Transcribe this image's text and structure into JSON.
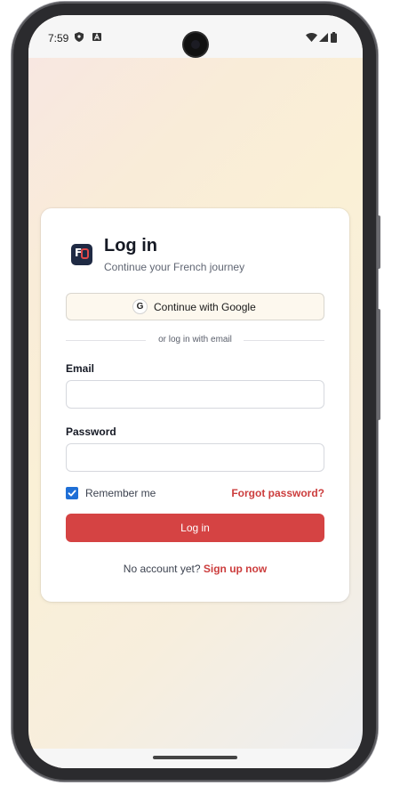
{
  "status_bar": {
    "time": "7:59",
    "left_icons": [
      "shield-icon",
      "a-badge-icon"
    ],
    "right_icons": [
      "wifi-icon",
      "signal-icon",
      "battery-icon"
    ]
  },
  "login": {
    "title": "Log in",
    "subtitle": "Continue your French journey",
    "logo_icon": "app-logo-icon",
    "google_badge": "G",
    "google_label": "Continue with Google",
    "divider_text": "or log in with email",
    "email_label": "Email",
    "email_value": "",
    "password_label": "Password",
    "password_value": "",
    "remember_label": "Remember me",
    "remember_checked": true,
    "forgot_label": "Forgot password?",
    "login_button": "Log in",
    "footer_prefix": "No account yet? ",
    "signup_link": "Sign up now"
  },
  "colors": {
    "accent_red": "#d54343",
    "link_red": "#cc3d3d",
    "checkbox_blue": "#1f6fd6",
    "title_dark": "#151924"
  }
}
